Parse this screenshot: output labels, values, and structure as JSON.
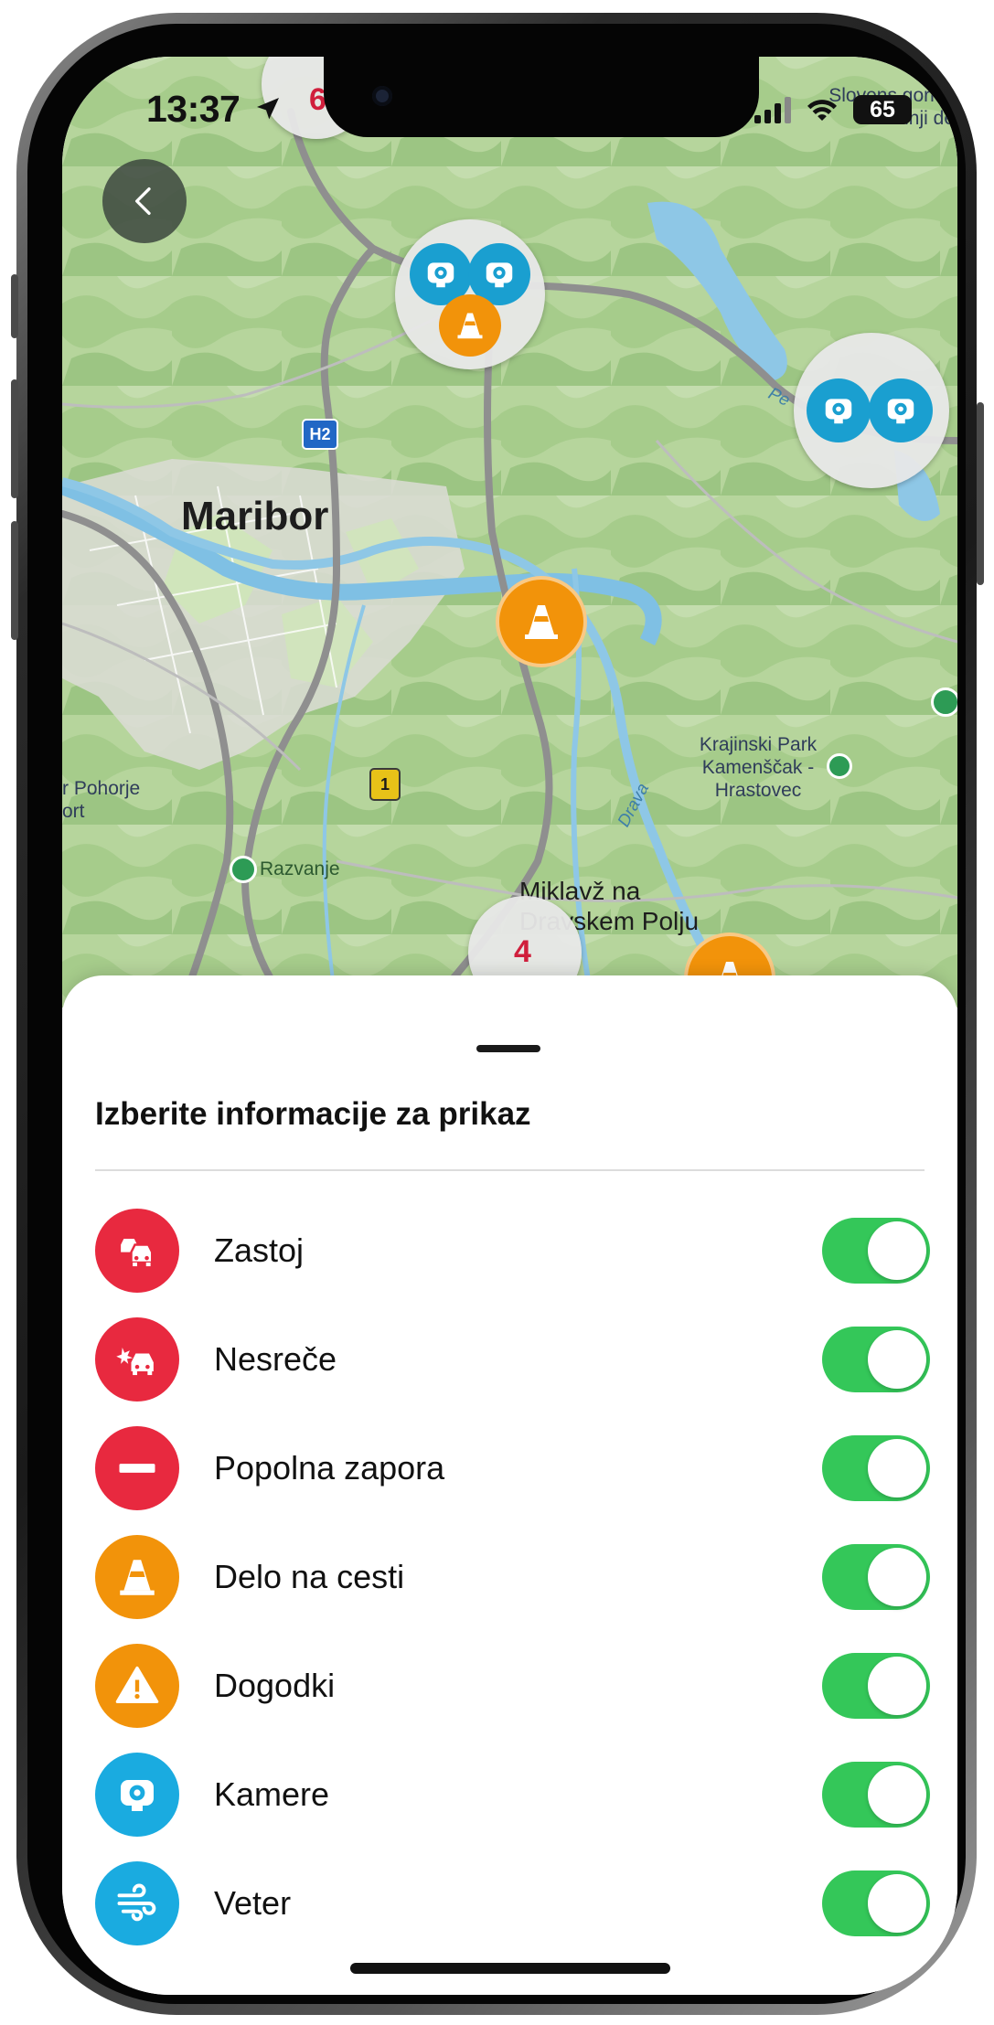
{
  "status_bar": {
    "time": "13:37",
    "battery": "65"
  },
  "map": {
    "city_label": "Maribor",
    "road_badge_h2": "H2",
    "road_badge_1": "1",
    "labels": {
      "krajinski": "Krajinski Park Kamenščak - Hrastovec",
      "razvanje": "Razvanje",
      "miklavz": "Miklavž na Dravskem Polju",
      "pohorje": "r Pohorje ort",
      "slovenske": "Slovens gorice osrednji de",
      "drava": "Drava",
      "pe": "Pe"
    },
    "clusters": {
      "top_count": "6",
      "bottom_count": "4"
    },
    "colors": {
      "camera": "#1a9fd0",
      "roadwork": "#f2930a"
    }
  },
  "sheet": {
    "title": "Izberite informacije za prikaz",
    "items": [
      {
        "label": "Zastoj",
        "icon": "traffic-jam-icon",
        "color": "#e8293f",
        "enabled": true
      },
      {
        "label": "Nesreče",
        "icon": "accident-icon",
        "color": "#e8293f",
        "enabled": true
      },
      {
        "label": "Popolna zapora",
        "icon": "road-closed-icon",
        "color": "#e8293f",
        "enabled": true
      },
      {
        "label": "Delo na cesti",
        "icon": "traffic-cone-icon",
        "color": "#f2930a",
        "enabled": true
      },
      {
        "label": "Dogodki",
        "icon": "warning-icon",
        "color": "#f2930a",
        "enabled": true
      },
      {
        "label": "Kamere",
        "icon": "camera-icon",
        "color": "#1aabe0",
        "enabled": true
      },
      {
        "label": "Veter",
        "icon": "wind-icon",
        "color": "#1aabe0",
        "enabled": true
      }
    ]
  }
}
